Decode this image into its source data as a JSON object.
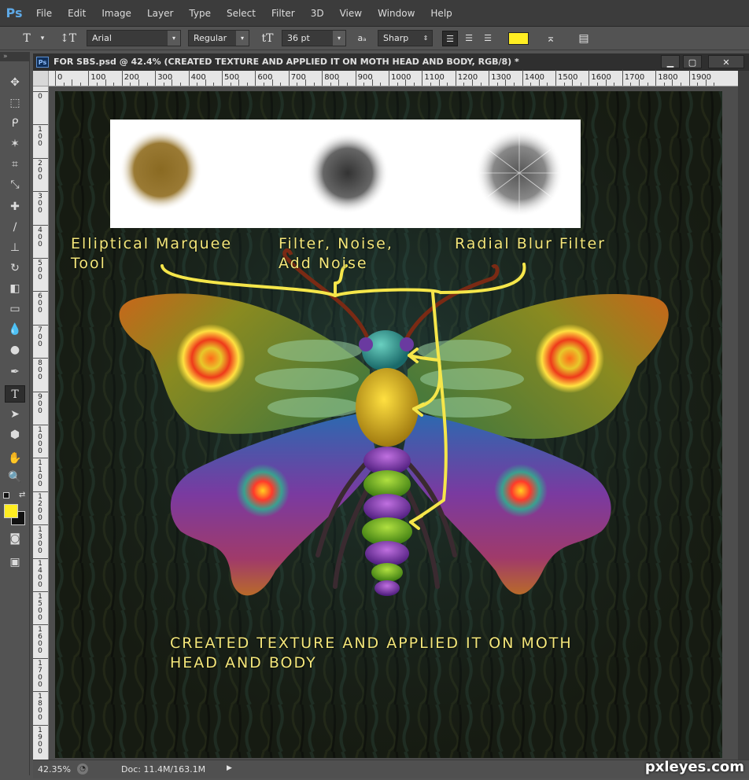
{
  "app": {
    "logo": "Ps"
  },
  "menu": [
    "File",
    "Edit",
    "Image",
    "Layer",
    "Type",
    "Select",
    "Filter",
    "3D",
    "View",
    "Window",
    "Help"
  ],
  "options": {
    "font_family": "Arial",
    "font_style": "Regular",
    "font_size": "36 pt",
    "aa_label": "aₐ",
    "antialias": "Sharp",
    "text_color": "#ffee22"
  },
  "document": {
    "title": "FOR SBS.psd @ 42.4% (CREATED TEXTURE AND APPLIED IT ON MOTH HEAD AND BODY, RGB/8) *",
    "icon_label": "Ps"
  },
  "ruler": {
    "h_labels": [
      "0",
      "100",
      "200",
      "300",
      "400",
      "500",
      "600",
      "700",
      "800",
      "900",
      "1000",
      "1100",
      "1200",
      "1300",
      "1400",
      "1500",
      "1600",
      "1700",
      "1800",
      "1900"
    ],
    "v_labels": [
      "0",
      "100",
      "200",
      "300",
      "400",
      "500",
      "600",
      "700",
      "800",
      "900",
      "1000",
      "1100",
      "1200",
      "1300",
      "1400",
      "1500",
      "1600",
      "1700",
      "1800",
      "1900"
    ]
  },
  "artwork": {
    "label1_line1": "Elliptical Marquee",
    "label1_line2": "Tool",
    "label2_line1": "Filter, Noise,",
    "label2_line2": "Add Noise",
    "label3": "Radial Blur Filter",
    "caption_line1": "CREATED TEXTURE AND APPLIED IT ON MOTH",
    "caption_line2": "HEAD AND BODY"
  },
  "status": {
    "zoom": "42.35%",
    "doc_info": "Doc: 11.4M/163.1M"
  },
  "watermark": "pxleyes.com",
  "colors": {
    "foreground": "#ffee22",
    "background": "#111111"
  }
}
